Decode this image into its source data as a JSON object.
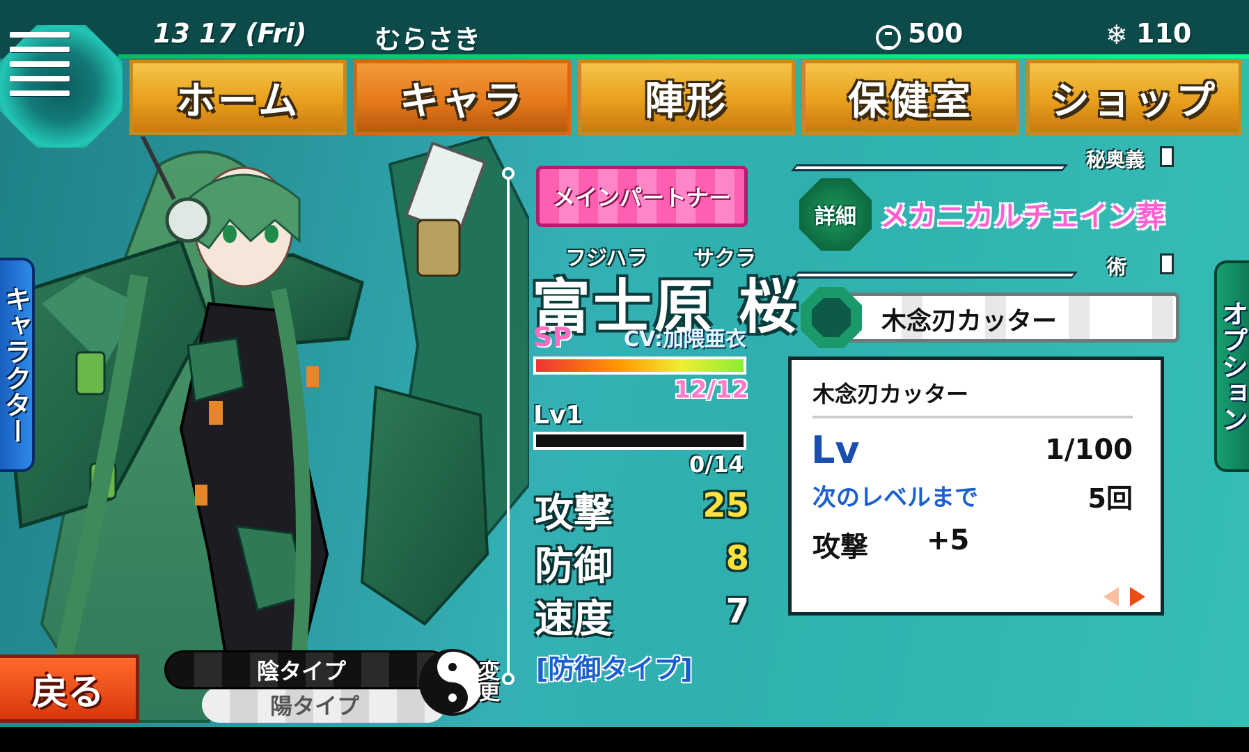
{
  "status": {
    "date": "13  17 (Fri)",
    "player_name": "むらさき",
    "coins": "500",
    "gems": "110",
    "coin_icon": "coin-icon",
    "gem_icon": "snowflake-icon"
  },
  "nav": {
    "tabs": [
      {
        "label": "ホーム",
        "active": false
      },
      {
        "label": "キャラ",
        "active": true
      },
      {
        "label": "陣形",
        "active": false
      },
      {
        "label": "保健室",
        "active": false
      },
      {
        "label": "ショップ",
        "active": false
      }
    ]
  },
  "side": {
    "left_tab": "キャラクター",
    "right_tab": "オプション"
  },
  "character": {
    "partner_badge": "メインパートナー",
    "family_reading": "フジハラ",
    "given_reading": "サクラ",
    "name": "富士原 桜",
    "rarity": "SP",
    "cv": "CV:加隈亜衣",
    "hp_text": "12/12",
    "hp_fraction": 1.0,
    "level": "Lv1",
    "exp_text": "0/14",
    "exp_fraction": 0.0,
    "stats": [
      {
        "label": "攻撃",
        "value": "25",
        "highlight": true
      },
      {
        "label": "防御",
        "value": "8",
        "highlight": true
      },
      {
        "label": "速度",
        "value": "7",
        "highlight": false
      }
    ],
    "type": "[防御タイプ]"
  },
  "skills": {
    "ougi_header": "秘奥義",
    "detail_button": "詳細",
    "ougi_name": "メカニカルチェイン葬",
    "jutsu_header": "術",
    "jutsu_name": "木念刃カッター",
    "detail": {
      "title": "木念刃カッター",
      "lv_label": "Lv",
      "lv_value": "1/100",
      "next_label": "次のレベルまで",
      "next_value": "5回",
      "atk_label": "攻撃",
      "atk_value": "+5"
    }
  },
  "bottom": {
    "back_label": "戻る",
    "yin_type": "陰タイプ",
    "yang_type": "陽タイプ",
    "change_label": "変更"
  },
  "colors": {
    "accent_tab": "#e8a01c",
    "active_tab": "#e67a1c",
    "partner_pink": "#ff5fb0",
    "back_orange": "#ff6a2a"
  }
}
